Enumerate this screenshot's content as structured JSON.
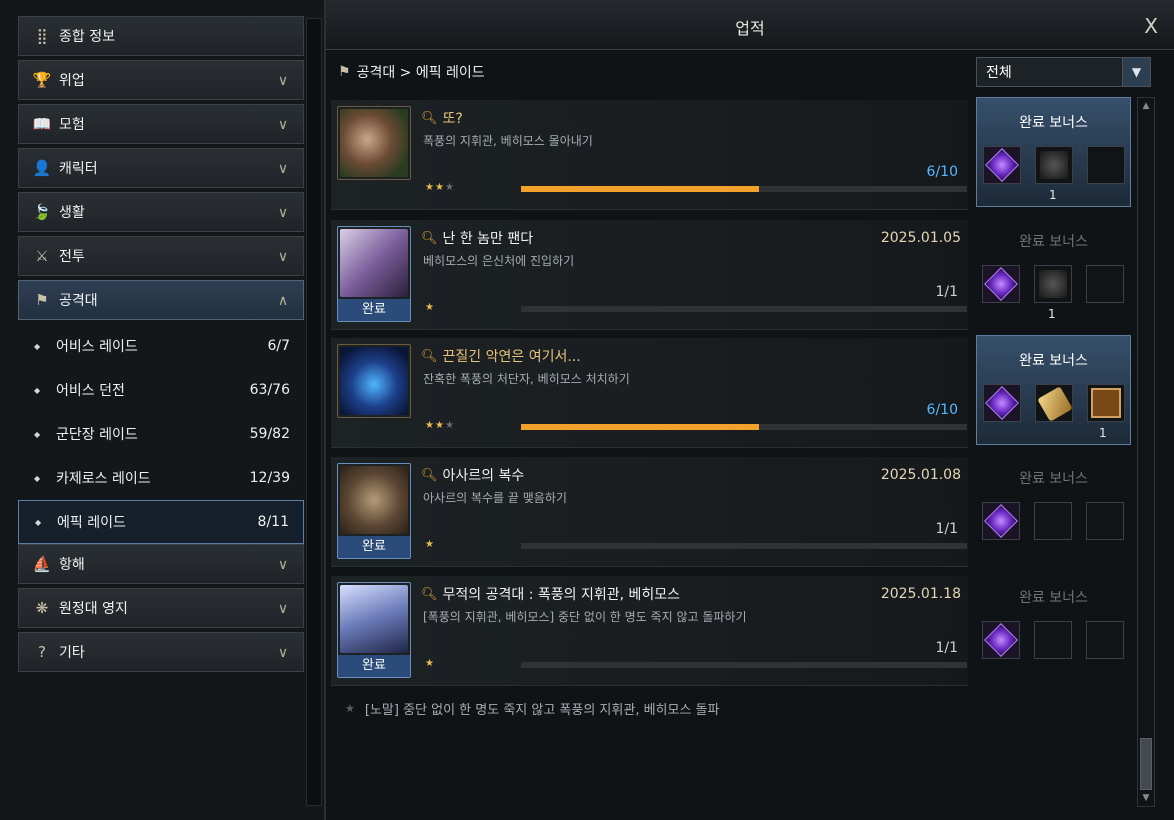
{
  "window": {
    "title": "업적",
    "close_label": "X"
  },
  "breadcrumb": "공격대 > 에픽 레이드",
  "filter": {
    "selected": "전체"
  },
  "sidebar": {
    "menus_top": [
      {
        "label": "종합 정보",
        "icon": "grid-icon",
        "glyph": "⣿"
      },
      {
        "label": "위업",
        "icon": "trophy-icon",
        "glyph": "🏆"
      },
      {
        "label": "모험",
        "icon": "book-icon",
        "glyph": "📖"
      },
      {
        "label": "캐릭터",
        "icon": "person-icon",
        "glyph": "👤"
      },
      {
        "label": "생활",
        "icon": "leaf-icon",
        "glyph": "🍃"
      },
      {
        "label": "전투",
        "icon": "crossed-swords-icon",
        "glyph": "⚔"
      },
      {
        "label": "공격대",
        "icon": "raid-icon",
        "glyph": "⚑"
      }
    ],
    "subitems": [
      {
        "label": "어비스 레이드",
        "count": "6/7"
      },
      {
        "label": "어비스 던전",
        "count": "63/76"
      },
      {
        "label": "군단장 레이드",
        "count": "59/82"
      },
      {
        "label": "카제로스 레이드",
        "count": "12/39"
      },
      {
        "label": "에픽 레이드",
        "count": "8/11"
      }
    ],
    "menus_bottom": [
      {
        "label": "항해",
        "icon": "ship-icon",
        "glyph": "⛵"
      },
      {
        "label": "원정대 영지",
        "icon": "estate-icon",
        "glyph": "❋"
      },
      {
        "label": "기타",
        "icon": "question-icon",
        "glyph": "?"
      }
    ]
  },
  "achievements": [
    {
      "title": "또?",
      "desc": "폭풍의 지휘관, 베히모스 몰아내기",
      "date": "",
      "progress": "6/10",
      "progress_fraction": 0.6,
      "stars": 2,
      "completed": false,
      "bonus_label": "완료 보너스",
      "bonus_qty": "1",
      "bonus_active": true
    },
    {
      "title": "난 한 놈만 팬다",
      "desc": "베히모스의 은신처에 진입하기",
      "date": "2025.01.05",
      "progress": "1/1",
      "progress_fraction": 1,
      "stars": 1,
      "completed": true,
      "bonus_label": "완료 보너스",
      "bonus_qty": "1",
      "bonus_active": false
    },
    {
      "title": "끈질긴 악연은 여기서...",
      "desc": "잔혹한 폭풍의 처단자, 베히모스 처치하기",
      "date": "",
      "progress": "6/10",
      "progress_fraction": 0.6,
      "stars": 2,
      "completed": false,
      "bonus_label": "완료 보너스",
      "bonus_qty": "1",
      "bonus_active": true
    },
    {
      "title": "아사르의 복수",
      "desc": "아사르의 복수를 끝 맺음하기",
      "date": "2025.01.08",
      "progress": "1/1",
      "progress_fraction": 1,
      "stars": 1,
      "completed": true,
      "bonus_label": "완료 보너스",
      "bonus_qty": "",
      "bonus_active": false
    },
    {
      "title": "무적의 공격대 : 폭풍의 지휘관, 베히모스",
      "desc": "[폭풍의 지휘관, 베히모스] 중단 없이 한 명도 죽지 않고 돌파하기",
      "date": "2025.01.18",
      "progress": "1/1",
      "progress_fraction": 1,
      "stars": 1,
      "completed": true,
      "bonus_label": "완료 보너스",
      "bonus_qty": "",
      "bonus_active": false
    }
  ],
  "completed_label": "완료",
  "hidden_achievement": "[노말] 중단 없이 한 명도 죽지 않고 폭풍의 지휘관, 베히모스 돌파",
  "colors": {
    "accent_blue": "#53b9ff",
    "progress_orange": "#f2a12c",
    "date_gold": "#e3d6b4",
    "completed_blue": "#2b4b7a"
  }
}
